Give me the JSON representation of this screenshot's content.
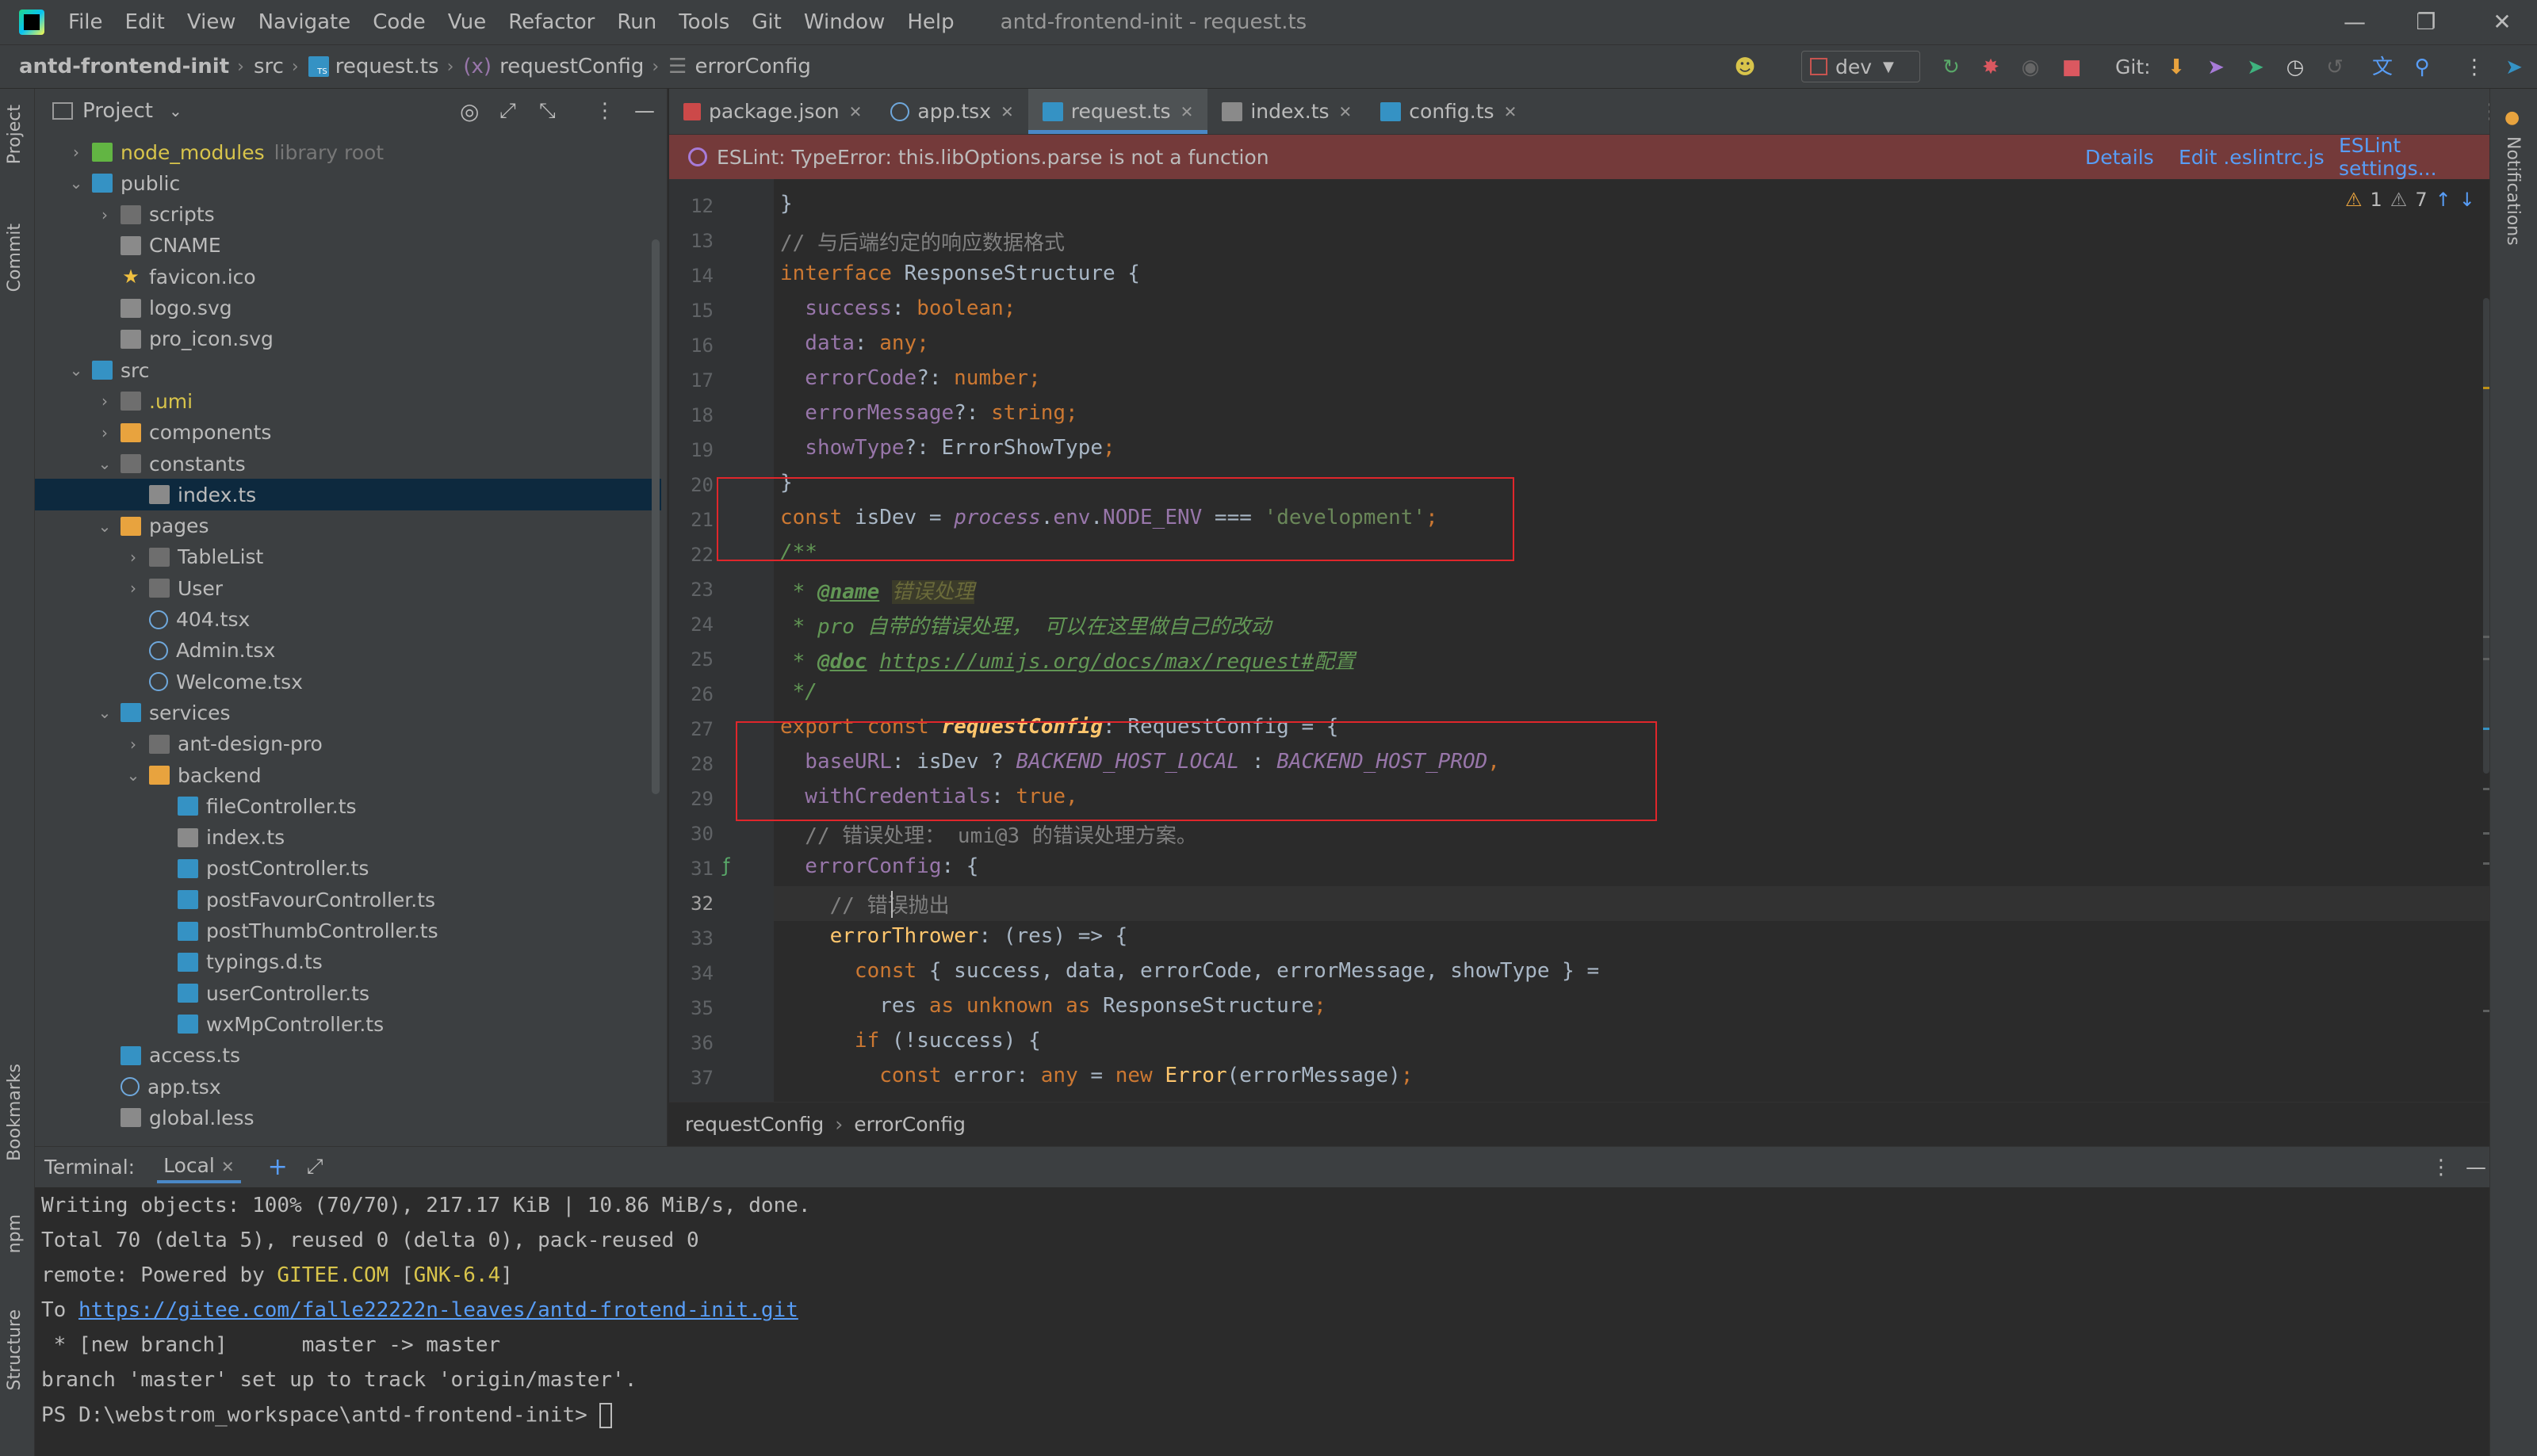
{
  "titlebar": {
    "menu": [
      "File",
      "Edit",
      "View",
      "Navigate",
      "Code",
      "Vue",
      "Refactor",
      "Run",
      "Tools",
      "Git",
      "Window",
      "Help"
    ],
    "window_title": "antd-frontend-init - request.ts"
  },
  "navbar": {
    "project": "antd-frontend-init",
    "folder": "src",
    "file": "request.ts",
    "symbol1": "requestConfig",
    "symbol2": "errorConfig",
    "branch": "dev",
    "git_label": "Git:"
  },
  "left_strip": {
    "project": "Project",
    "commit": "Commit",
    "bookmarks": "Bookmarks",
    "npm": "npm",
    "structure": "Structure"
  },
  "right_strip": {
    "notifications": "Notifications"
  },
  "project_panel": {
    "title": "Project",
    "tree": [
      {
        "label": "node_modules",
        "extra": "library root",
        "depth": 1,
        "arrow": "collapsed",
        "icon": "folder-green"
      },
      {
        "label": "public",
        "depth": 1,
        "arrow": "expanded",
        "icon": "folder-blue"
      },
      {
        "label": "scripts",
        "depth": 2,
        "arrow": "collapsed",
        "icon": "folder-grey"
      },
      {
        "label": "CNAME",
        "depth": 2,
        "arrow": "none",
        "icon": "file-misc"
      },
      {
        "label": "favicon.ico",
        "depth": 2,
        "arrow": "none",
        "icon": "file-star"
      },
      {
        "label": "logo.svg",
        "depth": 2,
        "arrow": "none",
        "icon": "file-misc"
      },
      {
        "label": "pro_icon.svg",
        "depth": 2,
        "arrow": "none",
        "icon": "file-misc"
      },
      {
        "label": "src",
        "depth": 1,
        "arrow": "expanded",
        "icon": "folder-blue"
      },
      {
        "label": ".umi",
        "depth": 2,
        "arrow": "collapsed",
        "icon": "folder-grey"
      },
      {
        "label": "components",
        "depth": 2,
        "arrow": "collapsed",
        "icon": "folder-yellow"
      },
      {
        "label": "constants",
        "depth": 2,
        "arrow": "expanded",
        "icon": "folder-grey"
      },
      {
        "label": "index.ts",
        "depth": 3,
        "arrow": "none",
        "icon": "file-misc",
        "selected": true
      },
      {
        "label": "pages",
        "depth": 2,
        "arrow": "expanded",
        "icon": "folder-yellow"
      },
      {
        "label": "TableList",
        "depth": 3,
        "arrow": "collapsed",
        "icon": "folder-grey"
      },
      {
        "label": "User",
        "depth": 3,
        "arrow": "collapsed",
        "icon": "folder-grey"
      },
      {
        "label": "404.tsx",
        "depth": 3,
        "arrow": "none",
        "icon": "file-react"
      },
      {
        "label": "Admin.tsx",
        "depth": 3,
        "arrow": "none",
        "icon": "file-react"
      },
      {
        "label": "Welcome.tsx",
        "depth": 3,
        "arrow": "none",
        "icon": "file-react"
      },
      {
        "label": "services",
        "depth": 2,
        "arrow": "expanded",
        "icon": "folder-blue"
      },
      {
        "label": "ant-design-pro",
        "depth": 3,
        "arrow": "collapsed",
        "icon": "folder-grey"
      },
      {
        "label": "backend",
        "depth": 3,
        "arrow": "expanded",
        "icon": "folder-yellow"
      },
      {
        "label": "fileController.ts",
        "depth": 4,
        "arrow": "none",
        "icon": "file-ts"
      },
      {
        "label": "index.ts",
        "depth": 4,
        "arrow": "none",
        "icon": "file-misc"
      },
      {
        "label": "postController.ts",
        "depth": 4,
        "arrow": "none",
        "icon": "file-ts"
      },
      {
        "label": "postFavourController.ts",
        "depth": 4,
        "arrow": "none",
        "icon": "file-ts"
      },
      {
        "label": "postThumbController.ts",
        "depth": 4,
        "arrow": "none",
        "icon": "file-ts"
      },
      {
        "label": "typings.d.ts",
        "depth": 4,
        "arrow": "none",
        "icon": "file-ts"
      },
      {
        "label": "userController.ts",
        "depth": 4,
        "arrow": "none",
        "icon": "file-ts"
      },
      {
        "label": "wxMpController.ts",
        "depth": 4,
        "arrow": "none",
        "icon": "file-ts"
      },
      {
        "label": "access.ts",
        "depth": 2,
        "arrow": "none",
        "icon": "file-ts"
      },
      {
        "label": "app.tsx",
        "depth": 2,
        "arrow": "none",
        "icon": "file-react"
      },
      {
        "label": "global.less",
        "depth": 2,
        "arrow": "none",
        "icon": "file-misc"
      }
    ]
  },
  "tabs": [
    {
      "label": "package.json",
      "active": false
    },
    {
      "label": "app.tsx",
      "active": false
    },
    {
      "label": "request.ts",
      "active": true
    },
    {
      "label": "index.ts",
      "active": false
    },
    {
      "label": "config.ts",
      "active": false
    }
  ],
  "eslint": {
    "message": "ESLint: TypeError: this.libOptions.parse is not a function",
    "details": "Details",
    "edit": "Edit .eslintrc.js",
    "settings": "ESLint settings..."
  },
  "inspections": {
    "warnings": "1",
    "weak": "7"
  },
  "line_numbers": [
    "12",
    "13",
    "14",
    "15",
    "16",
    "17",
    "18",
    "19",
    "20",
    "21",
    "22",
    "23",
    "24",
    "25",
    "26",
    "27",
    "28",
    "29",
    "30",
    "31",
    "32",
    "33",
    "34",
    "35",
    "36",
    "37"
  ],
  "current_line": "32",
  "code": {
    "l12": "}",
    "l13": "// 与后端约定的响应数据格式",
    "l14_kw": "interface",
    "l14_rest": " ResponseStructure {",
    "l15_p": "  success",
    "l15_t": "boolean",
    "l16_p": "  data",
    "l16_t": "any",
    "l17_p": "  errorCode",
    "l17_t": "number",
    "l18_p": "  errorMessage",
    "l18_t": "string",
    "l19_p": "  showType",
    "l19_t": "ErrorShowType",
    "l20": "}",
    "l21_kw": "const",
    "l21_var": "isDev",
    "l21_obj": "process",
    "l21_env": "env",
    "l21_node": "NODE_ENV",
    "l21_str": "'development'",
    "l22": "/**",
    "l23_tag": "@name",
    "l23_text": "错误处理",
    "l24_text": " * pro 自带的错误处理， 可以在这里做自己的改动",
    "l25_tag": "@doc",
    "l25_link": "https://umijs.org/docs/max/request#",
    "l25_text": "配置",
    "l26": " */",
    "l27_kw": "export const",
    "l27_name": "requestConfig",
    "l27_type": "RequestConfig",
    "l28_p": "  baseURL",
    "l28_var": "isDev",
    "l28_c1": "BACKEND_HOST_LOCAL",
    "l28_c2": "BACKEND_HOST_PROD",
    "l29_p": "  withCredentials",
    "l29_v": "true",
    "l30": "  // 错误处理： umi@3 的错误处理方案。",
    "l31_p": "  errorConfig",
    "l32": "    // 错误抛出",
    "l33_fn": "errorThrower",
    "l33_arg": "res",
    "l34_kw": "const",
    "l34_vars": "success, data, errorCode, errorMessage, showType",
    "l35_res": "res",
    "l35_kw1": "as",
    "l35_kw2": "unknown",
    "l35_kw3": "as",
    "l35_type": "ResponseStructure",
    "l36_kw": "if",
    "l36_var": "success",
    "l37_kw": "const",
    "l37_var": "error",
    "l37_type": "any",
    "l37_new": "new",
    "l37_cls": "Error",
    "l37_arg": "errorMessage"
  },
  "editor_breadcrumb": [
    "requestConfig",
    "errorConfig"
  ],
  "terminal": {
    "label": "Terminal:",
    "tab": "Local",
    "lines": {
      "t1": "Writing objects: 100% (70/70), 217.17 KiB | 10.86 MiB/s, done.",
      "t2": "Total 70 (delta 5), reused 0 (delta 0), pack-reused 0",
      "t3_a": "remote: Powered by ",
      "t3_b": "GITEE.COM",
      "t3_c": " [",
      "t3_d": "GNK-6.4",
      "t3_e": "]",
      "t4_a": "To ",
      "t4_link": "https://gitee.com/falle22222n-leaves/antd-frotend-init.git",
      "t5": " * [new branch]      master -> master",
      "t6": "branch 'master' set up to track 'origin/master'.",
      "t7": "PS D:\\webstrom_workspace\\antd-frontend-init> "
    }
  },
  "colors": {
    "background": "#2b2b2b",
    "panel": "#3c3f41",
    "error_bar": "#743a3a",
    "highlight_box": "#e0262b",
    "keyword": "#cc7832",
    "string": "#6a8759",
    "property": "#9876aa"
  }
}
